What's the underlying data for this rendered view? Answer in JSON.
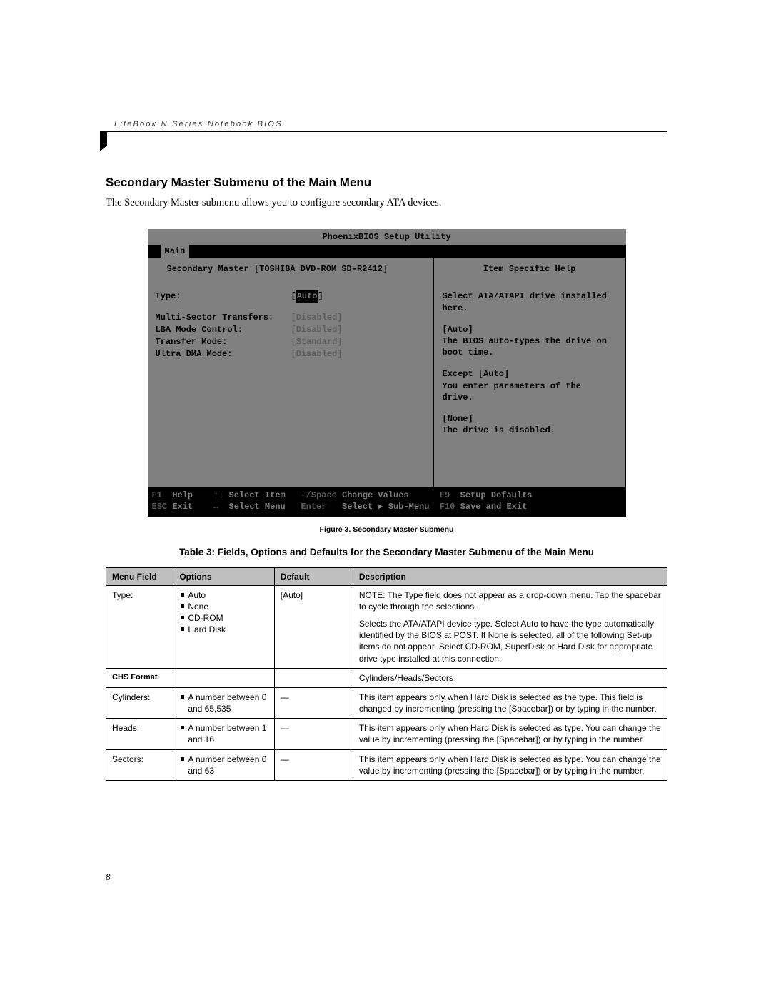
{
  "header": {
    "series": "LifeBook N Series Notebook BIOS"
  },
  "section": {
    "title": "Secondary Master Submenu of the Main Menu",
    "intro": "The Secondary Master submenu allows you to configure secondary ATA devices."
  },
  "bios": {
    "title": "PhoenixBIOS Setup Utility",
    "active_tab": "Main",
    "subtitle": "Secondary Master [TOSHIBA DVD-ROM SD-R2412]",
    "help_title": "Item Specific Help",
    "fields": {
      "type_label": "Type:",
      "type_value": "Auto",
      "mst_label": "Multi-Sector Transfers:",
      "mst_value": "[Disabled]",
      "lba_label": "LBA Mode Control:",
      "lba_value": "[Disabled]",
      "tm_label": "Transfer Mode:",
      "tm_value": "[Standard]",
      "udma_label": "Ultra DMA Mode:",
      "udma_value": "[Disabled]"
    },
    "help": {
      "p1": "Select ATA/ATAPI drive installed here.",
      "p2a": "[Auto]",
      "p2b": "The BIOS auto-types the drive on boot time.",
      "p3a": "Except [Auto]",
      "p3b": "You enter parameters of the drive.",
      "p4a": "[None]",
      "p4b": "The drive is disabled."
    },
    "footer": {
      "r1": {
        "k1": "F1",
        "t1": "Help",
        "k2": "↑↓",
        "t2": "Select Item",
        "k3": "-/Space",
        "t3": "Change Values",
        "k4": "F9",
        "t4": "Setup Defaults"
      },
      "r2": {
        "k1": "ESC",
        "t1": "Exit",
        "k2": "↔",
        "t2": "Select Menu",
        "k3": "Enter",
        "t3": "Select ▶ Sub-Menu",
        "k4": "F10",
        "t4": "Save and Exit"
      }
    }
  },
  "figure_caption": "Figure 3.  Secondary Master Submenu",
  "table_title": "Table 3: Fields, Options and Defaults for the Secondary Master Submenu of the Main Menu",
  "table": {
    "headers": {
      "c1": "Menu Field",
      "c2": "Options",
      "c3": "Default",
      "c4": "Description"
    },
    "rows": [
      {
        "field": "Type:",
        "options": [
          "Auto",
          "None",
          "CD-ROM",
          "Hard Disk"
        ],
        "default": "[Auto]",
        "desc": [
          "NOTE: The Type field does not appear as a drop-down menu. Tap the spacebar to cycle through the selections.",
          "Selects the ATA/ATAPI device type. Select Auto to have the type automatically identified by the BIOS at POST. If None is selected, all of the following Set-up items do not appear. Select CD-ROM, SuperDisk or Hard Disk for appropriate drive type installed at this connection."
        ]
      },
      {
        "field": "CHS Format",
        "options": [],
        "default": "",
        "desc": [
          "Cylinders/Heads/Sectors"
        ],
        "is_chs": true
      },
      {
        "field": "Cylinders:",
        "options": [
          "A number between 0 and 65,535"
        ],
        "default": "—",
        "desc": [
          "This item appears only when Hard Disk is selected as the type. This field is changed by incrementing (pressing the [Spacebar]) or by typing in the number."
        ]
      },
      {
        "field": "Heads:",
        "options": [
          "A number between 1 and 16"
        ],
        "default": "—",
        "desc": [
          "This item appears only when Hard Disk is selected as type. You can change the value by incrementing (pressing the [Spacebar]) or by typing in the number."
        ]
      },
      {
        "field": "Sectors:",
        "options": [
          "A number between 0 and 63"
        ],
        "default": "—",
        "desc": [
          "This item appears only when Hard Disk is selected as type. You can change the value by incrementing (pressing the [Spacebar]) or by typing in the number."
        ]
      }
    ]
  },
  "page_number": "8"
}
